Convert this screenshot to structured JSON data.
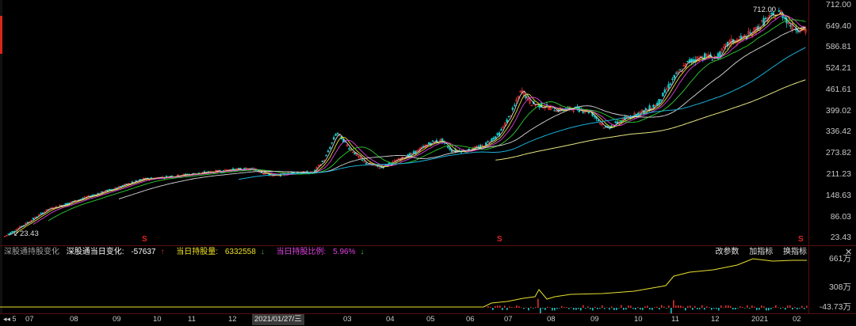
{
  "colors": {
    "background": "#000000",
    "up": "#e03030",
    "down": "#18c8c8",
    "ma_white": "#d8d8d8",
    "ma_yellow": "#e8e030",
    "ma_magenta": "#e040e0",
    "ma_green": "#30d030",
    "ma_cyan": "#18b0d8",
    "ma_long": "#e6e680"
  },
  "price_axis": {
    "labels": [
      "712.00",
      "649.40",
      "586.81",
      "524.21",
      "461.61",
      "399.02",
      "336.42",
      "273.82",
      "211.23",
      "148.63",
      "86.03",
      "23.43"
    ]
  },
  "chart": {
    "max_label": "712.00",
    "min_label": "23.43",
    "event_markers": [
      "S",
      "S",
      "S"
    ]
  },
  "indicator": {
    "name": "深股通持股变化",
    "field1_label": "深股通当日变化:",
    "field1_value": "-57637",
    "field2_label": "当日持股量:",
    "field2_value": "6332558",
    "field3_label": "当日持股比例:",
    "field3_value": "5.96%",
    "tool1": "改参数",
    "tool2": "加指标",
    "tool3": "换指标",
    "close": "✕",
    "axis_labels": [
      "661万",
      "308万",
      "-43.73万"
    ]
  },
  "time_axis": {
    "nav": "◂◂ 5",
    "cursor": "2021/01/27/三",
    "labels": [
      "07",
      "08",
      "09",
      "10",
      "11",
      "12",
      "03",
      "04",
      "05",
      "06",
      "07",
      "08",
      "09",
      "10",
      "11",
      "12",
      "2021",
      "02"
    ]
  }
}
